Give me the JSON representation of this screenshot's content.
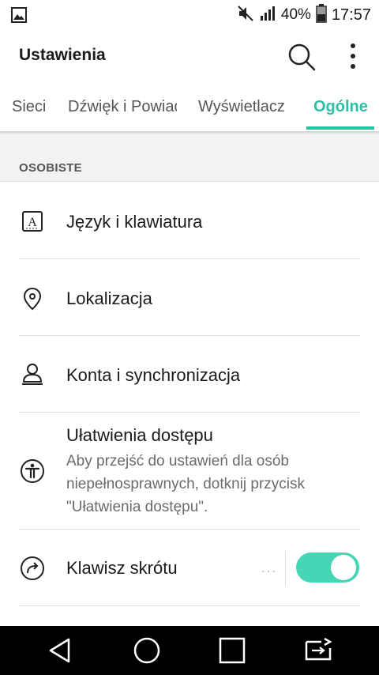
{
  "status_bar": {
    "left_icon": "gallery-icon",
    "icons": [
      "mute-icon",
      "signal-icon",
      "battery-icon"
    ],
    "battery": "40%",
    "time": "17:57"
  },
  "app_bar": {
    "title": "Ustawienia",
    "icons": [
      "search-icon",
      "more-vert-icon"
    ]
  },
  "tabs": [
    {
      "label": "Sieci",
      "active": false
    },
    {
      "label": "Dźwięk i Powiadomienia",
      "active": false
    },
    {
      "label": "Wyświetlacz",
      "active": false
    },
    {
      "label": "Ogólne",
      "active": true
    }
  ],
  "section": {
    "title": "OSOBISTE"
  },
  "items": [
    {
      "label": "Język i klawiatura",
      "icon": "language-keyboard-icon"
    },
    {
      "label": "Lokalizacja",
      "icon": "location-pin-icon"
    },
    {
      "label": "Konta i synchronizacja",
      "icon": "account-icon"
    },
    {
      "label": "Ułatwienia dostępu",
      "summary": "Aby przejść do ustawień dla osób niepełnosprawnych, dotknij przycisk \"Ułatwienia dostępu\".",
      "icon": "accessibility-icon"
    },
    {
      "label": "Klawisz skrótu",
      "icon": "shortcut-key-icon",
      "toggle": true
    }
  ],
  "nav_bar": {
    "icons": [
      "back-icon",
      "home-icon",
      "recents-icon",
      "dual-window-icon"
    ]
  },
  "colors": {
    "accent": "#2bbfa4",
    "toggle_on": "#45d6b6",
    "section_bg": "#f2f2f2",
    "nav_bg": "#000000"
  }
}
